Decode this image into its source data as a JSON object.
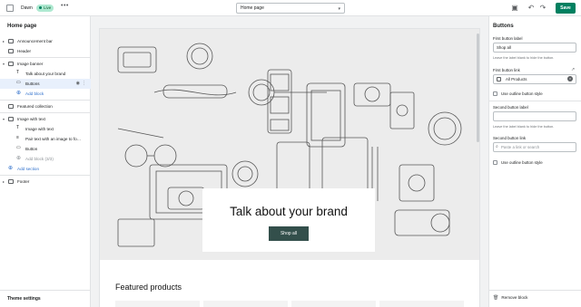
{
  "topbar": {
    "theme_name": "Dawn",
    "status_badge": "Live",
    "more_label": "•••",
    "page_select": "Home page",
    "save_label": "Save"
  },
  "sidebar": {
    "title": "Home page",
    "items": [
      {
        "label": "Announcement bar",
        "level": 0,
        "chevron": true
      },
      {
        "label": "Header",
        "level": 0,
        "chevron": false
      },
      {
        "label": "Image banner",
        "level": 0,
        "chevron": true,
        "expanded": true
      },
      {
        "label": "Talk about your brand",
        "level": 1
      },
      {
        "label": "Buttons",
        "level": 1,
        "selected": true
      },
      {
        "label": "Add block",
        "level": 1,
        "add": true
      },
      {
        "label": "Featured collection",
        "level": 0,
        "chevron": false
      },
      {
        "label": "Image with text",
        "level": 0,
        "chevron": true,
        "expanded": true
      },
      {
        "label": "Image with text",
        "level": 1
      },
      {
        "label": "Pair text with an image to fo…",
        "level": 1
      },
      {
        "label": "Button",
        "level": 1
      },
      {
        "label": "Add block (3/3)",
        "level": 1,
        "add": true,
        "muted": true
      },
      {
        "label": "Add section",
        "level": 0,
        "add": true
      },
      {
        "label": "Footer",
        "level": 0,
        "chevron": true
      }
    ],
    "footer": "Theme settings"
  },
  "preview": {
    "banner_heading": "Talk about your brand",
    "banner_button": "Shop all",
    "featured_title": "Featured products"
  },
  "settings": {
    "title": "Buttons",
    "first_label_title": "First button label",
    "first_label_value": "Shop all",
    "first_label_help": "Leave the label blank to hide the button.",
    "first_link_title": "First button link",
    "first_link_value": "All Products",
    "outline1": "Use outline button style",
    "second_label_title": "Second button label",
    "second_label_help": "Leave the label blank to hide the button.",
    "second_link_title": "Second button link",
    "second_link_placeholder": "Paste a link or search",
    "outline2": "Use outline button style",
    "remove_label": "Remove block"
  },
  "colors": {
    "accent": "#008060",
    "banner_button": "#334f4b",
    "selected_row": "#e8f0fc",
    "link_blue": "#2c6ecb"
  }
}
